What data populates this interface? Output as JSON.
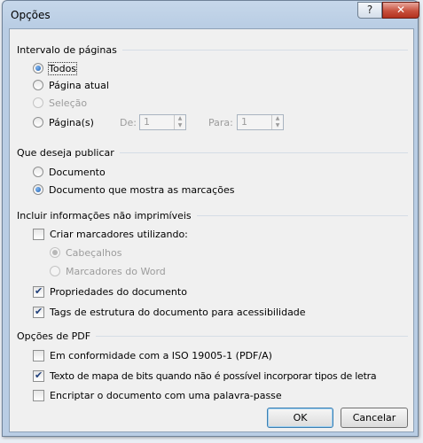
{
  "window": {
    "title": "Opções",
    "help": "?",
    "close": "✕"
  },
  "page_range": {
    "label": "Intervalo de páginas",
    "all": "Todos",
    "current": "Página atual",
    "selection": "Seleção",
    "pages": "Página(s)",
    "from_label": "De:",
    "from_value": "1",
    "to_label": "Para:",
    "to_value": "1",
    "selected": "all"
  },
  "publish": {
    "label": "Que deseja publicar",
    "document": "Documento",
    "document_markup": "Documento que mostra as marcações",
    "selected": "document_markup"
  },
  "non_printing": {
    "label": "Incluir informações não imprimíveis",
    "create_bookmarks": "Criar marcadores utilizando:",
    "create_bookmarks_checked": false,
    "headings": "Cabeçalhos",
    "word_bookmarks": "Marcadores do Word",
    "doc_properties": "Propriedades do documento",
    "doc_properties_checked": true,
    "structure_tags": "Tags de estrutura do documento para acessibilidade",
    "structure_tags_checked": true
  },
  "pdf": {
    "label": "Opções de PDF",
    "iso": "Em conformidade com a ISO 19005-1 (PDF/A)",
    "iso_checked": false,
    "bitmap": "Texto de mapa de bits quando não é possível incorporar tipos de letra",
    "bitmap_checked": true,
    "encrypt": "Encriptar o documento com uma palavra-passe",
    "encrypt_checked": false
  },
  "buttons": {
    "ok": "OK",
    "cancel": "Cancelar"
  }
}
